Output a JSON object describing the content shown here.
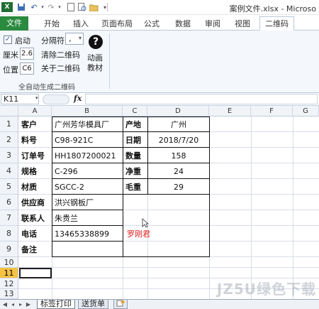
{
  "window": {
    "title": "案例文件.xlsx - Microso"
  },
  "ribbon_tabs": {
    "file": "文件",
    "home": "开始",
    "insert": "插入",
    "layout": "页面布局",
    "formulas": "公式",
    "data": "数据",
    "review": "审阅",
    "view": "视图",
    "qrcode": "二维码"
  },
  "ribbon": {
    "autostart_label": "启动",
    "separator_label": "分隔符",
    "separator_value": ",",
    "cm_label": "厘米",
    "cm_value": "2.6",
    "position_label": "位置",
    "position_value": "C6",
    "clear_label": "清除二维码",
    "about_label": "关于二维码",
    "animation_label_1": "动画",
    "animation_label_2": "教材",
    "group_caption": "全自动生成二维码"
  },
  "formula_bar": {
    "name_box": "K11",
    "fx": "fx",
    "formula": ""
  },
  "columns": [
    "A",
    "B",
    "C",
    "D",
    "E",
    "F",
    "G"
  ],
  "rows": [
    "1",
    "2",
    "3",
    "4",
    "5",
    "6",
    "7",
    "8",
    "9",
    "10",
    "11",
    "12",
    "13"
  ],
  "cells": {
    "a1": "客户",
    "b1": "广州芳华模具厂",
    "c1": "产地",
    "d1": "广州",
    "a2": "料号",
    "b2": "C98-921C",
    "c2": "日期",
    "d2": "2018/7/20",
    "a3": "订单号",
    "b3": "HH1807200021",
    "c3": "数量",
    "d3": "158",
    "a4": "规格",
    "b4": "C-296",
    "c4": "净重",
    "d4": "24",
    "a5": "材质",
    "b5": "SGCC-2",
    "c5": "毛重",
    "d5": "29",
    "a6": "供应商",
    "b6": "洪兴钢板厂",
    "a7": "联系人",
    "b7": "朱贵兰",
    "a8": "电话",
    "b8": "13465338899",
    "c8": "罗刚君",
    "a9": "备注"
  },
  "sheets": {
    "tab1": "标签打印",
    "tab2": "送货单"
  },
  "watermark": "JZ5U绿色下载",
  "colors": {
    "file_tab": "#2a8a3e",
    "selected_row_header": "#f5c244",
    "red_text": "#e02020"
  }
}
